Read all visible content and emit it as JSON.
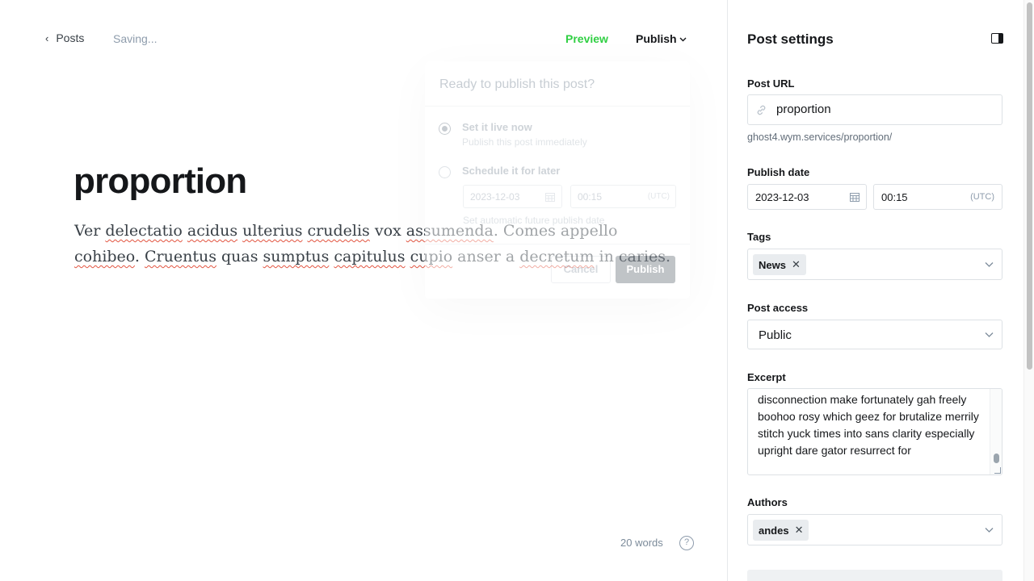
{
  "topbar": {
    "back_label": "Posts",
    "status": "Saving...",
    "preview_label": "Preview",
    "publish_label": "Publish"
  },
  "post": {
    "title": "proportion",
    "body": [
      {
        "t": "Ver ",
        "s": false
      },
      {
        "t": "delectatio",
        "s": true
      },
      {
        "t": " ",
        "s": false
      },
      {
        "t": "acidus",
        "s": true
      },
      {
        "t": " ",
        "s": false
      },
      {
        "t": "ulterius",
        "s": true
      },
      {
        "t": " ",
        "s": false
      },
      {
        "t": "crudelis",
        "s": true
      },
      {
        "t": " vox ",
        "s": false
      },
      {
        "t": "assumenda",
        "s": true
      },
      {
        "t": ". Comes appello ",
        "s": false
      },
      {
        "t": "cohibeo",
        "s": true
      },
      {
        "t": ". ",
        "s": false
      },
      {
        "t": "Cruentus",
        "s": true
      },
      {
        "t": " quas ",
        "s": false
      },
      {
        "t": "sumptus",
        "s": true
      },
      {
        "t": " ",
        "s": false
      },
      {
        "t": "capitulus",
        "s": true
      },
      {
        "t": " ",
        "s": false
      },
      {
        "t": "cupio",
        "s": true
      },
      {
        "t": " anser a ",
        "s": false
      },
      {
        "t": "decretum",
        "s": true
      },
      {
        "t": " in caries.",
        "s": false
      }
    ],
    "word_count": "20 words",
    "help_glyph": "?"
  },
  "publish_popover": {
    "heading": "Ready to publish this post?",
    "option_now_title": "Set it live now",
    "option_now_sub": "Publish this post immediately",
    "option_later_title": "Schedule it for later",
    "date": "2023-12-03",
    "time": "00:15",
    "tz": "(UTC)",
    "hint": "Set automatic future publish date",
    "cancel_label": "Cancel",
    "publish_label": "Publish"
  },
  "settings": {
    "title": "Post settings",
    "url_label": "Post URL",
    "url_value": "proportion",
    "url_hint": "ghost4.wym.services/proportion/",
    "date_label": "Publish date",
    "date_value": "2023-12-03",
    "time_value": "00:15",
    "tz": "(UTC)",
    "tags_label": "Tags",
    "tags": [
      "News"
    ],
    "access_label": "Post access",
    "access_value": "Public",
    "excerpt_label": "Excerpt",
    "excerpt_value": "disconnection make fortunately gah freely boohoo rosy which geez for brutalize merrily stitch yuck times into sans clarity especially upright dare gator resurrect for",
    "authors_label": "Authors",
    "authors": [
      "andes"
    ],
    "remove_glyph": "✕"
  },
  "colors": {
    "accent_green": "#30cf43",
    "spell_underline": "#e25440"
  }
}
